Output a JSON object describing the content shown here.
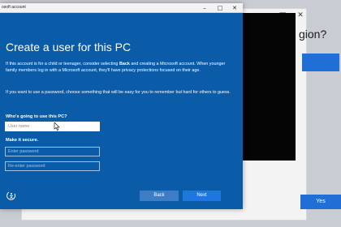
{
  "background_window": {
    "question_fragment": "gion?",
    "yes_label": "Yes",
    "controls": [
      "–",
      "□",
      "✕"
    ]
  },
  "dialog": {
    "window_title": "osoft account",
    "controls": [
      "–",
      "□",
      "✕"
    ],
    "heading": "Create a user for this PC",
    "para1_before": "If this account is for a child or teenager, consider selecting ",
    "para1_bold": "Back",
    "para1_after": " and creating a Microsoft account. When younger family members log in with a Microsoft account, they'll have privacy protections focused on their age.",
    "para2": "If you want to use a password, choose something that will be easy for you to remember but hard for others to guess.",
    "who_label": "Who's going to use this PC?",
    "username_placeholder": "User name",
    "secure_label": "Make it secure.",
    "password_placeholder": "Enter password",
    "reenter_placeholder": "Re-enter password",
    "back_label": "Back",
    "next_label": "Next"
  },
  "icons": {
    "accessibility": "accessibility-icon",
    "cursor": "mouse-cursor-icon"
  },
  "colors": {
    "dialog_blue": "#0a5ba8",
    "accent_blue": "#1f6fd6",
    "back_button": "#3d7dc6",
    "next_button": "#1e76e0"
  }
}
